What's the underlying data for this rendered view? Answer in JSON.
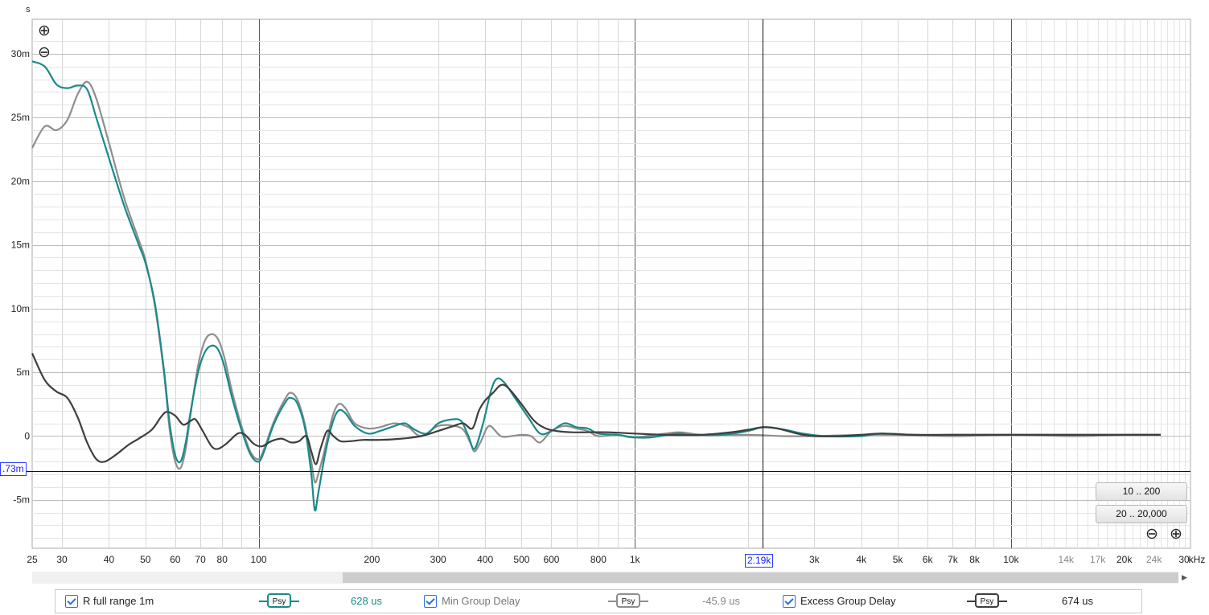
{
  "chart_data": {
    "type": "line",
    "title": "",
    "ylabel": "s",
    "xlabel": "",
    "x_unit_label": "kHz",
    "x_scale": "log",
    "xlim": [
      25,
      30000
    ],
    "ylim": [
      -0.0088,
      0.0327
    ],
    "grid": true,
    "y_ticks": [
      {
        "value": 0.03,
        "label": "30m"
      },
      {
        "value": 0.025,
        "label": "25m"
      },
      {
        "value": 0.02,
        "label": "20m"
      },
      {
        "value": 0.015,
        "label": "15m"
      },
      {
        "value": 0.01,
        "label": "10m"
      },
      {
        "value": 0.005,
        "label": "5m"
      },
      {
        "value": 0.0,
        "label": "0"
      },
      {
        "value": -0.005,
        "label": "-5m"
      }
    ],
    "x_ticks": [
      {
        "value": 25,
        "label": "25"
      },
      {
        "value": 30,
        "label": "30"
      },
      {
        "value": 40,
        "label": "40"
      },
      {
        "value": 50,
        "label": "50"
      },
      {
        "value": 60,
        "label": "60"
      },
      {
        "value": 70,
        "label": "70"
      },
      {
        "value": 80,
        "label": "80"
      },
      {
        "value": 100,
        "label": "100"
      },
      {
        "value": 200,
        "label": "200"
      },
      {
        "value": 300,
        "label": "300"
      },
      {
        "value": 400,
        "label": "400"
      },
      {
        "value": 500,
        "label": "500"
      },
      {
        "value": 600,
        "label": "600"
      },
      {
        "value": 800,
        "label": "800"
      },
      {
        "value": 1000,
        "label": "1k"
      },
      {
        "value": 3000,
        "label": "3k"
      },
      {
        "value": 4000,
        "label": "4k"
      },
      {
        "value": 5000,
        "label": "5k"
      },
      {
        "value": 6000,
        "label": "6k"
      },
      {
        "value": 7000,
        "label": "7k"
      },
      {
        "value": 8000,
        "label": "8k"
      },
      {
        "value": 10000,
        "label": "10k"
      },
      {
        "value": 14000,
        "label": "14k",
        "dim": true
      },
      {
        "value": 17000,
        "label": "17k",
        "dim": true
      },
      {
        "value": 20000,
        "label": "20k"
      },
      {
        "value": 24000,
        "label": "24k",
        "dim": true
      },
      {
        "value": 30000,
        "label": "30"
      }
    ],
    "cursor": {
      "x": 2190,
      "y": -0.00273,
      "x_label": "2.19k",
      "y_label": ".73m"
    },
    "series": [
      {
        "name": "R full range 1m",
        "color": "#1a8a8a",
        "points": [
          [
            25,
            0.0294
          ],
          [
            27,
            0.029
          ],
          [
            29,
            0.0276
          ],
          [
            31,
            0.0273
          ],
          [
            33,
            0.0275
          ],
          [
            35,
            0.0272
          ],
          [
            37,
            0.025
          ],
          [
            40,
            0.0218
          ],
          [
            44,
            0.018
          ],
          [
            48,
            0.015
          ],
          [
            50,
            0.0136
          ],
          [
            53,
            0.0104
          ],
          [
            56,
            0.0052
          ],
          [
            58,
            0.001
          ],
          [
            60,
            -0.0015
          ],
          [
            62,
            -0.002
          ],
          [
            64,
            -0.0005
          ],
          [
            66,
            0.002
          ],
          [
            69,
            0.005
          ],
          [
            72,
            0.0066
          ],
          [
            75,
            0.0071
          ],
          [
            78,
            0.0068
          ],
          [
            81,
            0.0055
          ],
          [
            85,
            0.003
          ],
          [
            90,
            0.0005
          ],
          [
            95,
            -0.0014
          ],
          [
            100,
            -0.002
          ],
          [
            104,
            -0.001
          ],
          [
            110,
            0.001
          ],
          [
            118,
            0.0027
          ],
          [
            122,
            0.003
          ],
          [
            127,
            0.0025
          ],
          [
            133,
            0.0005
          ],
          [
            138,
            -0.003
          ],
          [
            141,
            -0.0058
          ],
          [
            144,
            -0.0045
          ],
          [
            150,
            -0.0015
          ],
          [
            157,
            0.001
          ],
          [
            163,
            0.002
          ],
          [
            170,
            0.0018
          ],
          [
            180,
            0.0008
          ],
          [
            195,
            0.0002
          ],
          [
            210,
            0.0004
          ],
          [
            230,
            0.0008
          ],
          [
            245,
            0.001
          ],
          [
            260,
            0.0005
          ],
          [
            280,
            0.0002
          ],
          [
            300,
            0.001
          ],
          [
            325,
            0.0013
          ],
          [
            345,
            0.0012
          ],
          [
            360,
            0.0001
          ],
          [
            375,
            -0.001
          ],
          [
            395,
            0.001
          ],
          [
            415,
            0.0036
          ],
          [
            430,
            0.0045
          ],
          [
            450,
            0.0042
          ],
          [
            480,
            0.003
          ],
          [
            520,
            0.0015
          ],
          [
            560,
            0.0002
          ],
          [
            600,
            0.0004
          ],
          [
            650,
            0.001
          ],
          [
            700,
            0.0007
          ],
          [
            750,
            0.0006
          ],
          [
            800,
            0.0002
          ],
          [
            900,
            0.0001
          ],
          [
            1000,
            -0.0001
          ],
          [
            1100,
            -0.0001
          ],
          [
            1300,
            0.0002
          ],
          [
            1400,
            0.0001
          ],
          [
            1700,
            0.0001
          ],
          [
            2000,
            0.0004
          ],
          [
            2200,
            0.0007
          ],
          [
            2500,
            0.0005
          ],
          [
            2800,
            0.0002
          ],
          [
            3200,
            0.0
          ],
          [
            4000,
            0.0
          ],
          [
            4500,
            0.0002
          ],
          [
            5500,
            0.0001
          ],
          [
            7000,
            0.0001
          ],
          [
            10000,
            0.0001
          ],
          [
            15000,
            0.0001
          ],
          [
            20000,
            0.0001
          ],
          [
            25000,
            0.0001
          ]
        ]
      },
      {
        "name": "Min Group Delay",
        "color": "#8e8e8e",
        "points": [
          [
            25,
            0.0226
          ],
          [
            27,
            0.0243
          ],
          [
            29,
            0.024
          ],
          [
            31,
            0.0248
          ],
          [
            33,
            0.0268
          ],
          [
            35,
            0.0278
          ],
          [
            37,
            0.0265
          ],
          [
            40,
            0.023
          ],
          [
            44,
            0.0186
          ],
          [
            48,
            0.0154
          ],
          [
            50,
            0.0138
          ],
          [
            53,
            0.0102
          ],
          [
            56,
            0.005
          ],
          [
            58,
            0.0005
          ],
          [
            60,
            -0.002
          ],
          [
            62,
            -0.0025
          ],
          [
            64,
            -0.001
          ],
          [
            66,
            0.0018
          ],
          [
            69,
            0.0055
          ],
          [
            72,
            0.0075
          ],
          [
            75,
            0.008
          ],
          [
            78,
            0.0076
          ],
          [
            81,
            0.0062
          ],
          [
            85,
            0.0035
          ],
          [
            90,
            0.0008
          ],
          [
            95,
            -0.0012
          ],
          [
            100,
            -0.0018
          ],
          [
            104,
            -0.0008
          ],
          [
            110,
            0.0012
          ],
          [
            118,
            0.003
          ],
          [
            122,
            0.0034
          ],
          [
            127,
            0.0028
          ],
          [
            133,
            0.0008
          ],
          [
            138,
            -0.002
          ],
          [
            141,
            -0.0036
          ],
          [
            144,
            -0.003
          ],
          [
            150,
            -0.001
          ],
          [
            157,
            0.0015
          ],
          [
            163,
            0.0025
          ],
          [
            170,
            0.0022
          ],
          [
            180,
            0.001
          ],
          [
            195,
            0.0006
          ],
          [
            210,
            0.0007
          ],
          [
            230,
            0.001
          ],
          [
            250,
            0.0007
          ],
          [
            270,
            0.0
          ],
          [
            300,
            0.0008
          ],
          [
            330,
            0.0008
          ],
          [
            350,
            0.0005
          ],
          [
            365,
            -0.0005
          ],
          [
            375,
            -0.0012
          ],
          [
            390,
            -0.0004
          ],
          [
            410,
            0.0008
          ],
          [
            440,
            0.0
          ],
          [
            470,
            0.0
          ],
          [
            500,
            0.0001
          ],
          [
            530,
            0.0
          ],
          [
            560,
            -0.0005
          ],
          [
            600,
            0.0004
          ],
          [
            650,
            0.0008
          ],
          [
            700,
            0.0006
          ],
          [
            750,
            0.0004
          ],
          [
            800,
            0.0
          ],
          [
            900,
            0.0001
          ],
          [
            1000,
            -0.0001
          ],
          [
            1300,
            0.0003
          ],
          [
            1500,
            0.0001
          ],
          [
            2000,
            0.0001
          ],
          [
            2500,
            0.0
          ],
          [
            3000,
            0.0
          ],
          [
            4000,
            0.0001
          ],
          [
            5000,
            0.0001
          ],
          [
            7000,
            0.0
          ],
          [
            10000,
            0.0001
          ],
          [
            15000,
            0.0
          ],
          [
            20000,
            0.0001
          ],
          [
            25000,
            0.0001
          ]
        ]
      },
      {
        "name": "Excess Group Delay",
        "color": "#3e3e3e",
        "points": [
          [
            25,
            0.0065
          ],
          [
            27,
            0.0044
          ],
          [
            29,
            0.0035
          ],
          [
            31,
            0.003
          ],
          [
            33,
            0.0015
          ],
          [
            35,
            -0.0005
          ],
          [
            37,
            -0.0018
          ],
          [
            39,
            -0.002
          ],
          [
            42,
            -0.0014
          ],
          [
            45,
            -0.0007
          ],
          [
            48,
            -0.0002
          ],
          [
            52,
            0.0005
          ],
          [
            55,
            0.0015
          ],
          [
            57,
            0.0019
          ],
          [
            60,
            0.0016
          ],
          [
            63,
            0.0009
          ],
          [
            66,
            0.0012
          ],
          [
            68,
            0.0013
          ],
          [
            71,
            0.0004
          ],
          [
            75,
            -0.0008
          ],
          [
            78,
            -0.001
          ],
          [
            82,
            -0.0006
          ],
          [
            88,
            0.0002
          ],
          [
            92,
            0.0001
          ],
          [
            97,
            -0.0006
          ],
          [
            102,
            -0.0008
          ],
          [
            108,
            -0.0004
          ],
          [
            115,
            -0.0002
          ],
          [
            122,
            -0.0005
          ],
          [
            128,
            -0.0004
          ],
          [
            134,
            0.0
          ],
          [
            138,
            -0.0012
          ],
          [
            142,
            -0.0022
          ],
          [
            146,
            -0.001
          ],
          [
            152,
            0.0004
          ],
          [
            158,
            0.0
          ],
          [
            165,
            -0.0004
          ],
          [
            175,
            -0.0004
          ],
          [
            190,
            -0.0003
          ],
          [
            210,
            -0.0003
          ],
          [
            240,
            -0.0002
          ],
          [
            270,
            0.0
          ],
          [
            300,
            0.0004
          ],
          [
            330,
            0.0008
          ],
          [
            350,
            0.001
          ],
          [
            370,
            0.0006
          ],
          [
            385,
            0.002
          ],
          [
            400,
            0.0028
          ],
          [
            420,
            0.0034
          ],
          [
            440,
            0.004
          ],
          [
            460,
            0.0038
          ],
          [
            500,
            0.0025
          ],
          [
            540,
            0.0012
          ],
          [
            580,
            0.0006
          ],
          [
            620,
            0.0004
          ],
          [
            680,
            0.0003
          ],
          [
            750,
            0.0003
          ],
          [
            850,
            0.0003
          ],
          [
            1000,
            0.0002
          ],
          [
            1200,
            0.0001
          ],
          [
            1500,
            0.0001
          ],
          [
            1800,
            0.0003
          ],
          [
            2000,
            0.0005
          ],
          [
            2200,
            0.0007
          ],
          [
            2400,
            0.0006
          ],
          [
            2700,
            0.0002
          ],
          [
            3000,
            0.0
          ],
          [
            3500,
            0.0
          ],
          [
            4000,
            0.0001
          ],
          [
            4500,
            0.0002
          ],
          [
            5500,
            0.0001
          ],
          [
            7000,
            0.0001
          ],
          [
            10000,
            0.0001
          ],
          [
            15000,
            0.0001
          ],
          [
            20000,
            0.0001
          ],
          [
            25000,
            0.0001
          ]
        ]
      }
    ]
  },
  "controls": {
    "range_buttons": [
      {
        "label": "10 .. 200"
      },
      {
        "label": "20 .. 20,000"
      }
    ],
    "zoom_in_symbol": "⊕",
    "zoom_out_symbol": "⊖",
    "scroll_left_symbol": "◀",
    "scroll_right_symbol": "▶"
  },
  "legend": [
    {
      "name": "R full range 1m",
      "badge": "Psy",
      "value": "628 us",
      "color": "#1a8a8a",
      "value_color": "#1a8a8a"
    },
    {
      "name": "Min Group Delay",
      "badge": "Psy",
      "value": "-45.9 us",
      "color": "#8e8e8e",
      "value_color": "#888888"
    },
    {
      "name": "Excess Group Delay",
      "badge": "Psy",
      "value": "674 us",
      "color": "#3e3e3e",
      "value_color": "#222222"
    }
  ]
}
